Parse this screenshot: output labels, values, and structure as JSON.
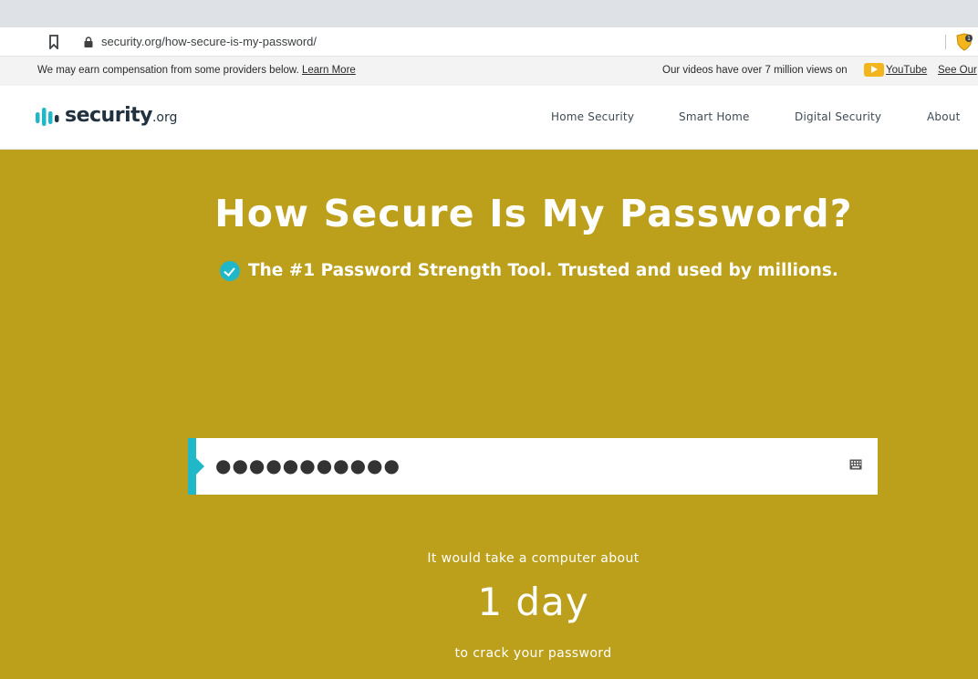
{
  "browser": {
    "url": "security.org/how-secure-is-my-password/"
  },
  "disclosure": {
    "text": "We may earn compensation from some providers below.",
    "learn_more": "Learn More",
    "views_text": "Our videos have over 7 million views on",
    "youtube_label": "YouTube",
    "see_our": "See Our"
  },
  "header": {
    "logo_text": "security",
    "logo_suffix": ".org",
    "nav": [
      {
        "label": "Home Security"
      },
      {
        "label": "Smart Home"
      },
      {
        "label": "Digital Security"
      },
      {
        "label": "About"
      }
    ]
  },
  "hero": {
    "title": "How Secure Is My Password?",
    "subtitle": "The #1 Password Strength Tool. Trusted and used by millions."
  },
  "password": {
    "masked_value": "●●●●●●●●●●●"
  },
  "result": {
    "pre_text": "It would take a computer about",
    "value": "1 day",
    "post_text": "to crack your password"
  },
  "colors": {
    "hero_bg": "#bca01c",
    "accent": "#20b7c8",
    "youtube_badge": "#f2b51c"
  },
  "icons": {
    "bookmark": "bookmark-icon",
    "lock": "lock-icon",
    "extension": "brave-shield-icon",
    "subtitle": "check-circle-icon",
    "keyboard": "keyboard-icon"
  }
}
